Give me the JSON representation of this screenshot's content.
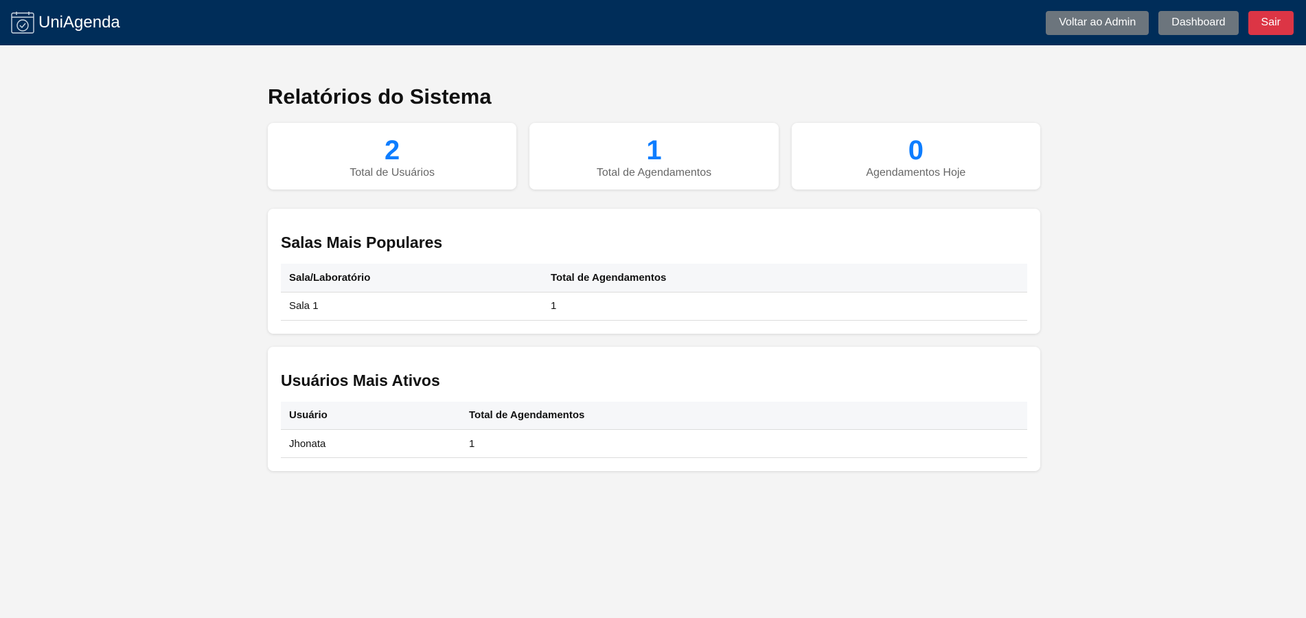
{
  "app": {
    "brand": "UniAgenda",
    "logo_icon": "calendar-check-icon"
  },
  "nav": {
    "back_admin": "Voltar ao Admin",
    "dashboard": "Dashboard",
    "logout": "Sair"
  },
  "colors": {
    "navbar": "#002d59",
    "accent": "#0d7dff",
    "danger": "#dc3545",
    "secondary": "#6c757d"
  },
  "page": {
    "title": "Relatórios do Sistema"
  },
  "stats": [
    {
      "value": "2",
      "label": "Total de Usuários"
    },
    {
      "value": "1",
      "label": "Total de Agendamentos"
    },
    {
      "value": "0",
      "label": "Agendamentos Hoje"
    }
  ],
  "popular_rooms": {
    "title": "Salas Mais Populares",
    "columns": [
      "Sala/Laboratório",
      "Total de Agendamentos"
    ],
    "rows": [
      [
        "Sala 1",
        "1"
      ]
    ]
  },
  "active_users": {
    "title": "Usuários Mais Ativos",
    "columns": [
      "Usuário",
      "Total de Agendamentos"
    ],
    "rows": [
      [
        "Jhonata",
        "1"
      ]
    ]
  }
}
